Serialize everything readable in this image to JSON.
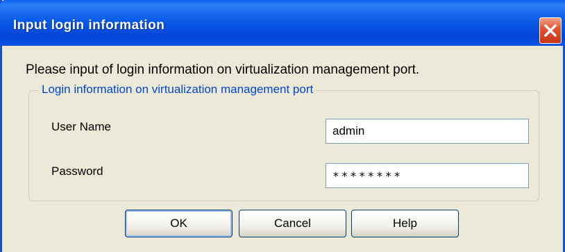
{
  "window": {
    "title": "Input login information"
  },
  "message": "Please input of login information on virtualization management port.",
  "group": {
    "legend": "Login information on virtualization management port",
    "fields": [
      {
        "label": "User Name",
        "value": "admin"
      },
      {
        "label": "Password",
        "value": "********"
      }
    ]
  },
  "buttons": {
    "ok": "OK",
    "cancel": "Cancel",
    "help": "Help"
  },
  "icons": {
    "close": "close-icon"
  },
  "colors": {
    "titlebar": "#0a5ae6",
    "close_button": "#e0502c",
    "legend_text": "#0046d5",
    "dialog_background": "#ece9d8"
  }
}
